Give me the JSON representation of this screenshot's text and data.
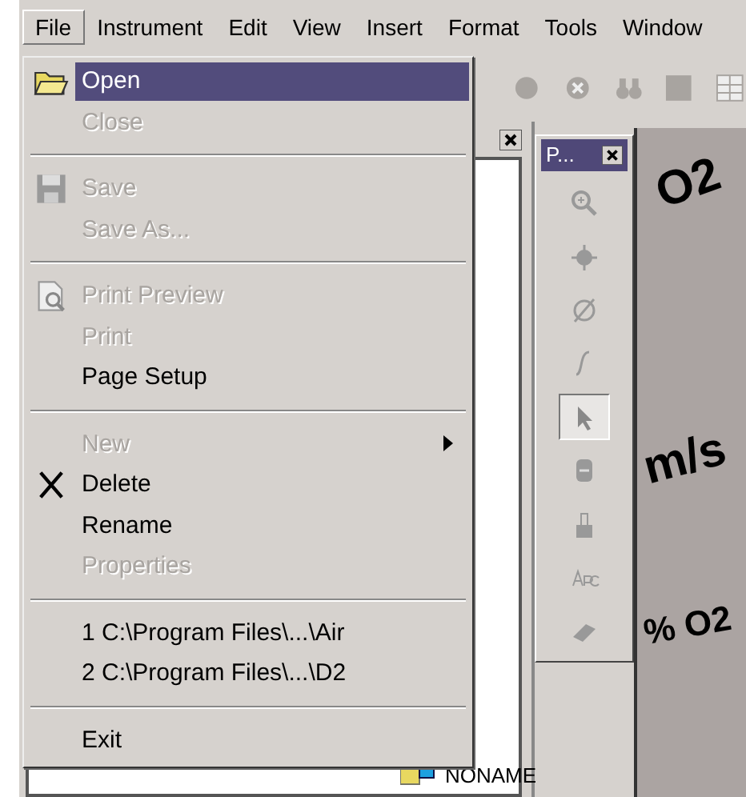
{
  "menu_bar": [
    {
      "label": "File",
      "selected": true
    },
    {
      "label": "Instrument",
      "selected": false
    },
    {
      "label": "Edit",
      "selected": false
    },
    {
      "label": "View",
      "selected": false
    },
    {
      "label": "Insert",
      "selected": false
    },
    {
      "label": "Format",
      "selected": false
    },
    {
      "label": "Tools",
      "selected": false
    },
    {
      "label": "Window",
      "selected": false
    }
  ],
  "file_menu": [
    {
      "kind": "item",
      "label": "Open",
      "disabled": false,
      "selected": true
    },
    {
      "kind": "item",
      "label": "Close",
      "disabled": true,
      "selected": false
    },
    {
      "kind": "separator"
    },
    {
      "kind": "item",
      "label": "Save",
      "disabled": true,
      "selected": false
    },
    {
      "kind": "item",
      "label": "Save As...",
      "disabled": true,
      "selected": false
    },
    {
      "kind": "separator"
    },
    {
      "kind": "item",
      "label": "Print Preview",
      "disabled": true,
      "selected": false
    },
    {
      "kind": "item",
      "label": "Print",
      "disabled": true,
      "selected": false
    },
    {
      "kind": "item",
      "label": "Page Setup",
      "disabled": false,
      "selected": false
    },
    {
      "kind": "separator"
    },
    {
      "kind": "submenu",
      "label": "New",
      "disabled": true,
      "selected": false
    },
    {
      "kind": "item",
      "label": "Delete",
      "disabled": false,
      "selected": false
    },
    {
      "kind": "item",
      "label": "Rename",
      "disabled": false,
      "selected": false
    },
    {
      "kind": "item",
      "label": "Properties",
      "disabled": true,
      "selected": false
    },
    {
      "kind": "separator"
    },
    {
      "kind": "item",
      "label": "1 C:\\Program Files\\...\\Air",
      "disabled": false,
      "selected": false
    },
    {
      "kind": "item",
      "label": "2 C:\\Program Files\\...\\D2",
      "disabled": false,
      "selected": false
    },
    {
      "kind": "separator"
    },
    {
      "kind": "item",
      "label": "Exit",
      "disabled": false,
      "selected": false
    }
  ],
  "palette": {
    "title": "P...",
    "tools": [
      {
        "selected": false
      },
      {
        "selected": false
      },
      {
        "selected": false
      },
      {
        "selected": false
      },
      {
        "selected": true
      },
      {
        "selected": false
      },
      {
        "selected": false
      },
      {
        "selected": false
      },
      {
        "selected": false
      }
    ]
  },
  "canvas": {
    "labels": [
      "O2",
      "m/s",
      "% O2"
    ]
  },
  "tree": {
    "items": [
      "NONAME"
    ]
  }
}
